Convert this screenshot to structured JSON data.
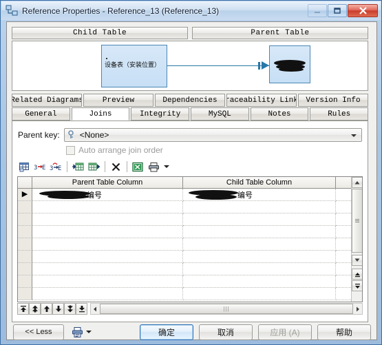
{
  "window": {
    "title": "Reference Properties - Reference_13 (Reference_13)",
    "icon": "reference-relationship-icon",
    "minimize_label": "Minimize",
    "maximize_label": "Restore",
    "close_label": "Close",
    "accent_color": "#3b6ea5",
    "close_color": "#c83d2c"
  },
  "table_buttons": {
    "child": "Child Table",
    "parent": "Parent Table"
  },
  "diagram": {
    "child_table_label": "设备表（安装位置）",
    "parent_table_label": "",
    "parent_table_redacted": true,
    "link_color": "#2878a8",
    "box_fill": "#c7dff5",
    "box_border": "#4a86b4"
  },
  "tabs": {
    "row1": [
      {
        "label": "Related Diagrams",
        "active": false
      },
      {
        "label": "Preview",
        "active": false
      },
      {
        "label": "Dependencies",
        "active": false
      },
      {
        "label": "Traceability Links",
        "active": false
      },
      {
        "label": "Version Info",
        "active": false
      }
    ],
    "row2": [
      {
        "label": "General",
        "active": false
      },
      {
        "label": "Joins",
        "active": true
      },
      {
        "label": "Integrity",
        "active": false
      },
      {
        "label": "MySQL",
        "active": false
      },
      {
        "label": "Notes",
        "active": false
      },
      {
        "label": "Rules",
        "active": false
      }
    ]
  },
  "joins": {
    "parent_key_label": "Parent key:",
    "parent_key_value": "<None>",
    "parent_key_icon": "key-icon",
    "auto_arrange_label": "Auto arrange join order",
    "auto_arrange_checked": false,
    "auto_arrange_enabled": false
  },
  "toolbar": {
    "items": [
      {
        "name": "edit-grid-icon",
        "tip": "Edit grid"
      },
      {
        "name": "add-join-icon",
        "tip": "Add join"
      },
      {
        "name": "remove-join-icon",
        "tip": "Remove join"
      },
      {
        "name": "insert-row-icon",
        "tip": "Insert row"
      },
      {
        "name": "append-row-icon",
        "tip": "Append row"
      },
      {
        "name": "delete-icon",
        "tip": "Delete"
      },
      {
        "name": "export-excel-icon",
        "tip": "Export to Excel"
      },
      {
        "name": "print-icon",
        "tip": "Print"
      }
    ]
  },
  "grid": {
    "columns": [
      "",
      "Parent Table Column",
      "Child Table Column",
      ""
    ],
    "rows": [
      {
        "selected": true,
        "marker": "▶",
        "parent_column": "编号",
        "parent_column_redacted": true,
        "child_column": "编号",
        "child_column_redacted": true
      },
      {
        "selected": false,
        "marker": "",
        "parent_column": "",
        "child_column": ""
      },
      {
        "selected": false,
        "marker": "",
        "parent_column": "",
        "child_column": ""
      },
      {
        "selected": false,
        "marker": "",
        "parent_column": "",
        "child_column": ""
      },
      {
        "selected": false,
        "marker": "",
        "parent_column": "",
        "child_column": ""
      },
      {
        "selected": false,
        "marker": "",
        "parent_column": "",
        "child_column": ""
      },
      {
        "selected": false,
        "marker": "",
        "parent_column": "",
        "child_column": ""
      },
      {
        "selected": false,
        "marker": "",
        "parent_column": "",
        "child_column": ""
      },
      {
        "selected": false,
        "marker": "",
        "parent_column": "",
        "child_column": ""
      }
    ]
  },
  "row_nav": {
    "buttons": [
      {
        "name": "move-first-icon",
        "tip": "Move to first"
      },
      {
        "name": "move-up-fast-icon",
        "tip": "Move up fast"
      },
      {
        "name": "move-up-icon",
        "tip": "Move up"
      },
      {
        "name": "move-down-icon",
        "tip": "Move down"
      },
      {
        "name": "move-down-fast-icon",
        "tip": "Move down fast"
      },
      {
        "name": "move-last-icon",
        "tip": "Move to last"
      }
    ]
  },
  "footer": {
    "less_label": "<< Less",
    "print_icon": "print-preview-icon",
    "ok_label": "确定",
    "cancel_label": "取消",
    "apply_label": "应用 (A)",
    "apply_enabled": false,
    "help_label": "帮助"
  }
}
